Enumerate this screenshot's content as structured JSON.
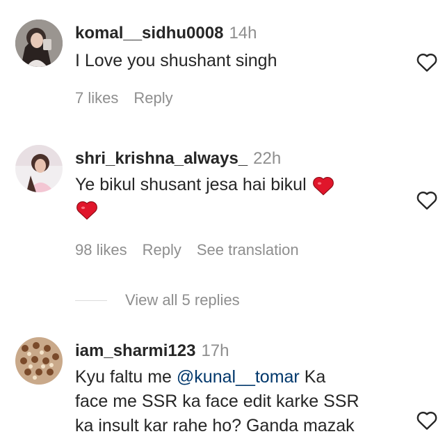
{
  "comments": [
    {
      "username": "komal__sidhu0008",
      "time": "14h",
      "text": "I Love you shushant singh",
      "likes": "7 likes",
      "reply": "Reply"
    },
    {
      "username": "shri_krishna_always_",
      "time": "22h",
      "text_line1": "Ye bikul shusant jesa hai bikul",
      "likes": "98 likes",
      "reply": "Reply",
      "see_translation": "See translation",
      "view_replies": "View all 5 replies"
    },
    {
      "username": "iam_sharmi123",
      "time": "17h",
      "text_prefix": "Kyu faltu me ",
      "mention": "@kunal__tomar",
      "text_line1_suffix": " Ka",
      "text_line2": "face me SSR ka face edit karke SSR",
      "text_line3": "ka insult kar rahe ho? Ganda mazak"
    }
  ],
  "icons": {
    "like": "heart-outline-icon",
    "emoji": "red-heart-emoji-icon"
  },
  "colors": {
    "username": "#262626",
    "secondary": "#8e8e8e",
    "mention": "#00376b",
    "heart_emoji": "#e0162b"
  }
}
